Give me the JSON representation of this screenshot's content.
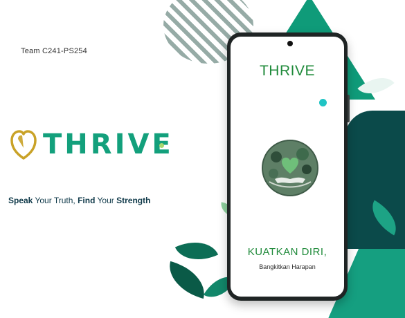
{
  "team_label": "Team C241-PS254",
  "brand": {
    "name": "THRIVE",
    "logo_icon": "heart-shield-icon",
    "colors": {
      "primary": "#13a07c",
      "logo": "#c9a227",
      "tagline": "#103a4a"
    }
  },
  "tagline": {
    "w1": "Speak",
    "w2": " Your Truth, ",
    "w3": "Find",
    "w4": " Your ",
    "w5": "Strength"
  },
  "phone": {
    "app_title": "THRIVE",
    "illustration": "hands-holding-heart-illustration",
    "headline": "KUATKAN DIRI,",
    "subline": "Bangkitkan Harapan",
    "colors": {
      "title": "#1f8a3a",
      "accent_dot": "#20c4c4"
    }
  }
}
